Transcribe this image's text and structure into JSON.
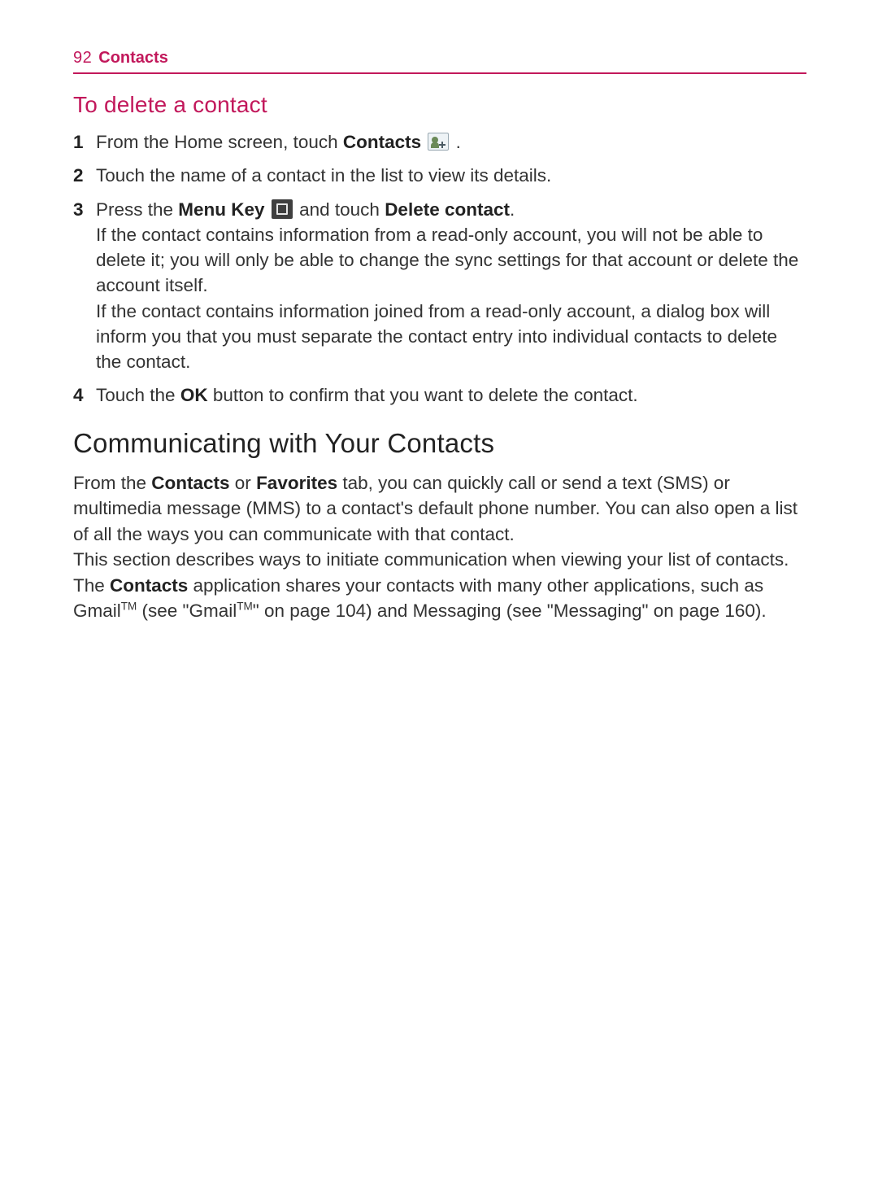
{
  "header": {
    "page_number": "92",
    "section": "Contacts"
  },
  "section1": {
    "title": "To delete a contact",
    "steps": [
      {
        "n": "1",
        "before_bold": "From the Home screen, touch ",
        "bold": "Contacts",
        "after_bold": " ",
        "icon": "contacts",
        "tail": " ."
      },
      {
        "n": "2",
        "plain": "Touch the name of a contact in the list to view its details."
      },
      {
        "n": "3",
        "l1_a": "Press the ",
        "l1_b": "Menu Key",
        "l1_c": " ",
        "l1_icon": "menukey",
        "l1_d": " and touch ",
        "l1_e": "Delete contact",
        "l1_f": ".",
        "para1": "If the contact contains information from a read-only account, you will not be able to delete it; you will only be able to change the sync settings for that account or delete the account itself.",
        "para2": "If the contact contains information joined from a read-only account, a dialog box will inform you that you must separate the contact entry into individual contacts to delete the contact."
      },
      {
        "n": "4",
        "before_bold": "Touch the ",
        "bold": "OK",
        "after_bold": " button to confirm that you want to delete the contact."
      }
    ]
  },
  "section2": {
    "title": "Communicating with Your Contacts",
    "p1_a": "From the ",
    "p1_b": "Contacts",
    "p1_c": " or ",
    "p1_d": "Favorites",
    "p1_e": " tab, you can quickly call or send a text (SMS) or multimedia message (MMS) to a contact's default phone number. You can also open a list of all the ways you can communicate with that contact.",
    "p2_a": "This section describes ways to initiate communication when viewing your list of contacts. The ",
    "p2_b": "Contacts",
    "p2_c": " application shares your contacts with many other applications, such as Gmail",
    "p2_tm1": "TM",
    "p2_d": " (see \"Gmail",
    "p2_tm2": "TM",
    "p2_e": "\" on page 104) and Messaging (see \"Messaging\" on page 160)."
  }
}
